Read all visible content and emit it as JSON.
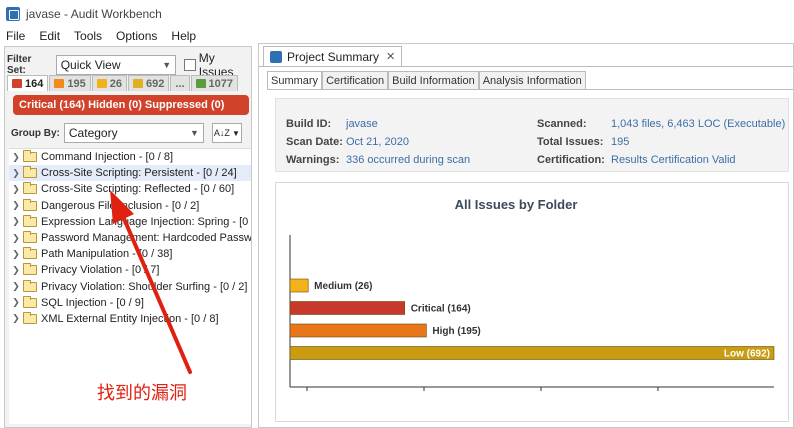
{
  "window": {
    "title": "javase - Audit Workbench"
  },
  "menu": [
    "File",
    "Edit",
    "Tools",
    "Options",
    "Help"
  ],
  "left": {
    "filter_set_label": "Filter Set:",
    "filter_set_value": "Quick View",
    "my_issues_label": "My Issues",
    "priority_tabs": [
      {
        "count": "164",
        "color": "#d0422a"
      },
      {
        "count": "195",
        "color": "#f08a1c"
      },
      {
        "count": "26",
        "color": "#f2b31a"
      },
      {
        "count": "692",
        "color": "#e0b020"
      },
      {
        "count": "...",
        "color": ""
      },
      {
        "count": "1077",
        "color": "#5c9c3c"
      }
    ],
    "summary_bar": "Critical (164) Hidden (0) Suppressed (0)",
    "group_by_label": "Group By:",
    "group_by_value": "Category",
    "sort_label": "A↓Z",
    "tree": [
      "Command Injection - [0 / 8]",
      "Cross-Site Scripting: Persistent - [0 / 24]",
      "Cross-Site Scripting: Reflected - [0 / 60]",
      "Dangerous File Inclusion - [0 / 2]",
      "Expression Language Injection: Spring - [0 /",
      "Password Management: Hardcoded Passwo",
      "Path Manipulation - [0 / 38]",
      "Privacy Violation - [0 / 7]",
      "Privacy Violation: Shoulder Surfing - [0 / 2]",
      "SQL Injection - [0 / 9]",
      "XML External Entity Injection - [0 / 8]"
    ]
  },
  "annotation": {
    "text": "找到的漏洞",
    "color": "#e02010"
  },
  "editor_tab": {
    "label": "Project Summary",
    "close": "✕"
  },
  "content_tabs": [
    "Summary",
    "Certification",
    "Build Information",
    "Analysis Information"
  ],
  "info": {
    "build_id_label": "Build ID:",
    "build_id": "javase",
    "scan_date_label": "Scan Date:",
    "scan_date": "Oct 21, 2020",
    "warnings_label": "Warnings:",
    "warnings": "336 occurred during scan",
    "scanned_label": "Scanned:",
    "scanned": "1,043 files, 6,463 LOC (Executable)",
    "total_issues_label": "Total Issues:",
    "total_issues": "195",
    "certification_label": "Certification:",
    "certification": "Results Certification Valid"
  },
  "chart_data": {
    "type": "bar",
    "orientation": "horizontal",
    "title": "All Issues by Folder",
    "categories": [
      "Medium (26)",
      "Critical (164)",
      "High (195)",
      "Low (692)"
    ],
    "values": [
      26,
      164,
      195,
      692
    ],
    "colors": [
      "#f2b31a",
      "#c9392b",
      "#e8771c",
      "#c99c12"
    ],
    "xlim": [
      0,
      692
    ],
    "grid": false
  }
}
